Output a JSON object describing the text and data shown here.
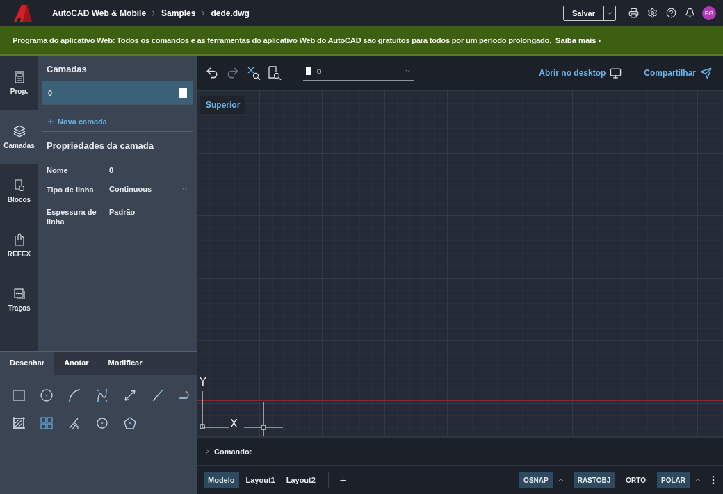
{
  "app_bar": {
    "breadcrumbs": [
      "AutoCAD Web & Mobile",
      "Samples",
      "dede.dwg"
    ],
    "save_button": "Salvar",
    "avatar": "FG"
  },
  "banner": {
    "text": "Programa do aplicativo Web: Todos os comandos e as ferramentas do aplicativo Web do AutoCAD são gratuitos para todos por um período prolongado.",
    "link": "Saiba mais ›"
  },
  "rail": [
    {
      "label": "Prop.",
      "kind": "props",
      "selected": false
    },
    {
      "label": "Camadas",
      "kind": "layers",
      "selected": true
    },
    {
      "label": "Blocos",
      "kind": "blocks",
      "selected": false
    },
    {
      "label": "REFEX",
      "kind": "xref",
      "selected": false
    },
    {
      "label": "Traços",
      "kind": "traces",
      "selected": false
    }
  ],
  "layers_panel": {
    "title": "Camadas",
    "layers": [
      {
        "name": "0",
        "selected": true,
        "color": "#ffffff"
      }
    ],
    "add_layer": "Nova camada"
  },
  "properties": {
    "title": "Propriedades da camada",
    "rows": [
      {
        "label": "Nome",
        "value": "0",
        "kind": "text"
      },
      {
        "label": "Tipo de linha",
        "value": "Continuous",
        "kind": "dropdown"
      },
      {
        "label": "Espessura de linha",
        "value": "Padrão",
        "kind": "text"
      }
    ]
  },
  "draw_tabs": [
    {
      "label": "Desenhar",
      "selected": true
    },
    {
      "label": "Anotar",
      "selected": false
    },
    {
      "label": "Modificar",
      "selected": false
    }
  ],
  "draw_tools": [
    {
      "kind": "rectangle"
    },
    {
      "kind": "circle"
    },
    {
      "kind": "arc"
    },
    {
      "kind": "spline"
    },
    {
      "kind": "dimension"
    },
    {
      "kind": "line"
    },
    {
      "kind": "polyline"
    },
    {
      "kind": "hatch"
    },
    {
      "kind": "array"
    },
    {
      "kind": "trim"
    },
    {
      "kind": "point"
    },
    {
      "kind": "polygon"
    }
  ],
  "toolbar": {
    "layer": "0",
    "open_desktop": "Abrir no desktop",
    "share": "Compartilhar"
  },
  "view_label": "Superior",
  "axes": {
    "x": "X",
    "y": "Y"
  },
  "command": {
    "prompt": "Comando:"
  },
  "layout_tabs": [
    {
      "label": "Modelo",
      "selected": true
    },
    {
      "label": "Layout1",
      "selected": false
    },
    {
      "label": "Layout2",
      "selected": false
    }
  ],
  "status_toggles": [
    {
      "label": "OSNAP",
      "on": true,
      "menu": true
    },
    {
      "label": "RASTOBJ",
      "on": true,
      "menu": false
    },
    {
      "label": "ORTO",
      "on": false,
      "menu": false
    },
    {
      "label": "POLAR",
      "on": true,
      "menu": true
    }
  ]
}
